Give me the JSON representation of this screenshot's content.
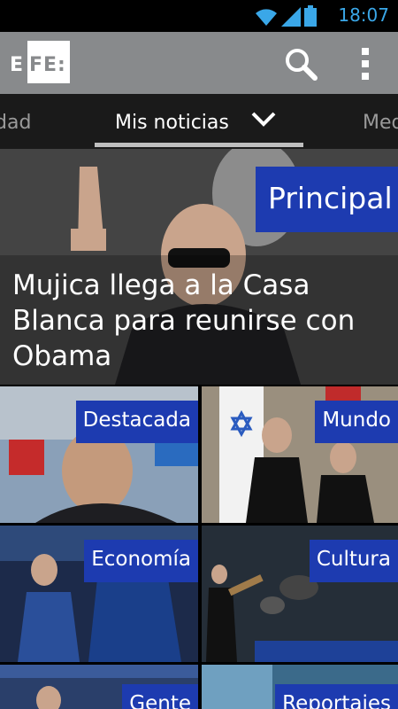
{
  "status_bar": {
    "time": "18:07",
    "icons": [
      "wifi-icon",
      "signal-icon",
      "battery-icon"
    ],
    "accent_color": "#3aa7e8"
  },
  "action_bar": {
    "logo_text": "EFE:",
    "search_icon": "search-icon",
    "menu_icon": "overflow-menu-icon"
  },
  "tabs": {
    "left": "dad",
    "active": "Mis noticias",
    "right": "Med"
  },
  "hero": {
    "badge": "Principal",
    "title": "Mujica llega a la Casa Blanca para reunirse con Obama"
  },
  "tiles": [
    {
      "label": "Destacada"
    },
    {
      "label": "Mundo"
    },
    {
      "label": "Economía"
    },
    {
      "label": "Cultura"
    },
    {
      "label": "Gente"
    },
    {
      "label": "Reportajes"
    }
  ],
  "colors": {
    "badge_blue": "#1d3bb0",
    "action_bar": "#888a8c",
    "tabs_bg": "#1a1a1a"
  }
}
